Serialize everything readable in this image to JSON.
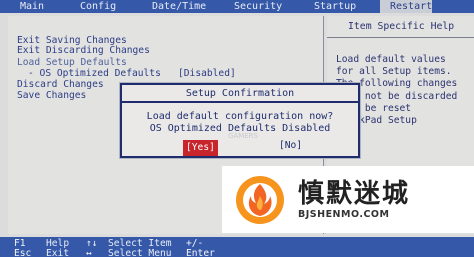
{
  "menubar": {
    "tabs": [
      {
        "label": "Main"
      },
      {
        "label": "Config"
      },
      {
        "label": "Date/Time"
      },
      {
        "label": "Security"
      },
      {
        "label": "Startup"
      },
      {
        "label": "Restart"
      }
    ]
  },
  "options": [
    {
      "label": "Exit Saving Changes"
    },
    {
      "label": "Exit Discarding Changes"
    },
    {
      "label": "Load Setup Defaults"
    },
    {
      "label": "- OS Optimized Defaults",
      "value": "[Disabled]"
    },
    {
      "label": "Discard Changes"
    },
    {
      "label": "Save Changes"
    }
  ],
  "help": {
    "title": "Item Specific Help",
    "text": "Load default values\nfor all Setup items.\nThe following changes\nwill not be discarded\nmust be reset\nThinkPad Setup\nity\nTime"
  },
  "dialog": {
    "title": "Setup Confirmation",
    "message_line1": "Load default configuration now?",
    "message_line2": "OS Optimized Defaults Disabled",
    "yes_label": "[Yes]",
    "no_label": "[No]"
  },
  "overlay": {
    "gamers": "GAMERS",
    "watermark_cn": "慎默迷城",
    "watermark_url": "BJSHENMO.COM"
  },
  "statusbar": {
    "row1": [
      {
        "key": "F1",
        "label": "Help"
      },
      {
        "key": "↑↓",
        "label": "Select Item"
      },
      {
        "key": "+/-",
        "label": ""
      }
    ],
    "row2": [
      {
        "key": "Esc",
        "label": "Exit"
      },
      {
        "key": "↔",
        "label": "Select Menu"
      },
      {
        "key": "Enter",
        "label": ""
      }
    ]
  }
}
